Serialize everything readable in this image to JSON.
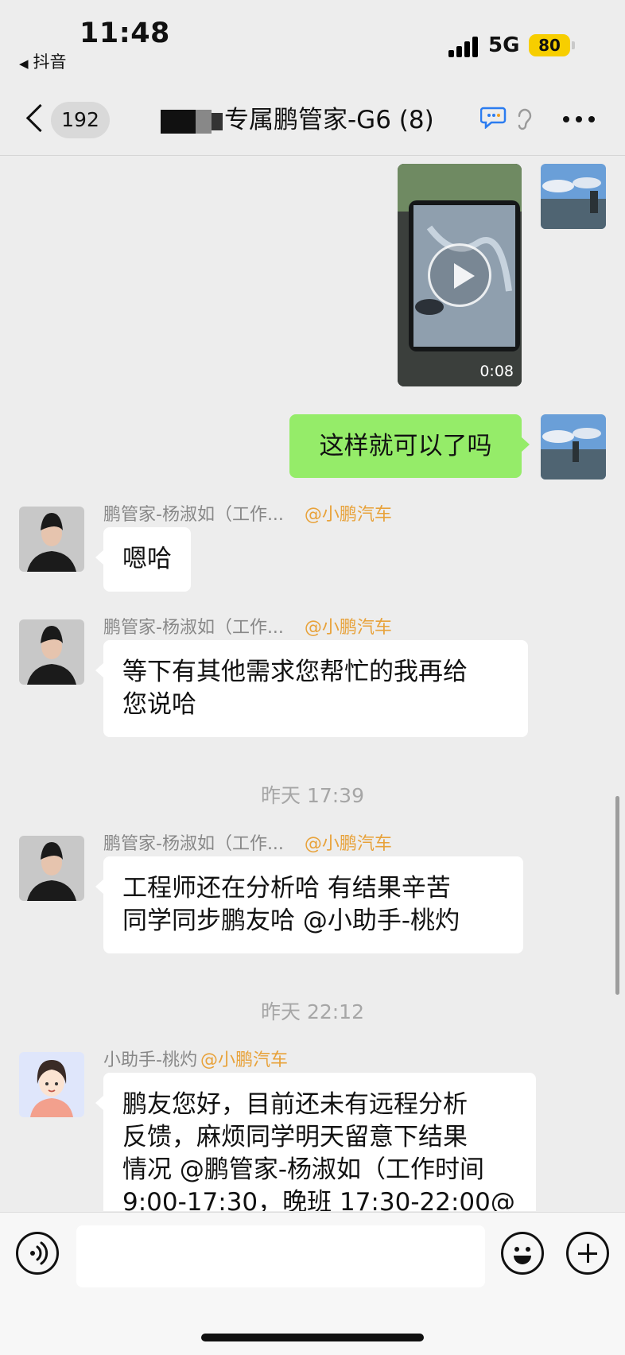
{
  "status_bar": {
    "time": "11:48",
    "back_app": "抖音",
    "network": "5G",
    "battery": "80",
    "battery_color": "#f7ce00"
  },
  "nav": {
    "unread_count": "192",
    "title": "专属鹏管家-G6 (8)"
  },
  "messages": {
    "video": {
      "duration": "0:08"
    },
    "me_text": "这样就可以了吗",
    "agent1": {
      "name": "鹏管家-杨淑如（工作...",
      "org": "@小鹏汽车",
      "text": "嗯哈"
    },
    "agent2": {
      "name": "鹏管家-杨淑如（工作...",
      "org": "@小鹏汽车",
      "lines": [
        "等下有其他需求您帮忙的我再给",
        "您说哈"
      ]
    },
    "ts1": "昨天 17:39",
    "agent3": {
      "name": "鹏管家-杨淑如（工作...",
      "org": "@小鹏汽车",
      "lines": [
        "工程师还在分析哈  有结果辛苦",
        "同学同步鹏友哈 @小助手-桃灼"
      ]
    },
    "ts2": "昨天 22:12",
    "assistant": {
      "name": "小助手-桃灼",
      "org": "@小鹏汽车",
      "lines": [
        "鹏友您好，目前还未有远程分析",
        "反馈，麻烦同学明天留意下结果",
        "情况 @鹏管家-杨淑如（工作时间",
        "9:00-17:30，晚班 17:30-22:00@"
      ]
    }
  },
  "input": {
    "placeholder": ""
  },
  "colors": {
    "me_bubble": "#95ec69",
    "org_tag": "#e8a23a",
    "background": "#ededed"
  }
}
